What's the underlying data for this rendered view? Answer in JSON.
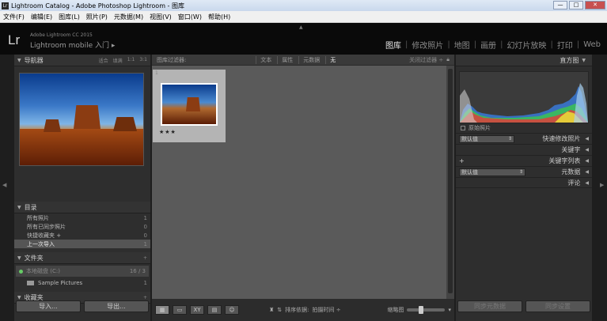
{
  "window": {
    "title": "Lightroom Catalog - Adobe Photoshop Lightroom - 图库",
    "app_icon": "Lr",
    "controls": [
      "—",
      "□",
      "✕"
    ]
  },
  "menu": [
    "文件(F)",
    "编辑(E)",
    "图库(L)",
    "照片(P)",
    "元数据(M)",
    "视图(V)",
    "窗口(W)",
    "帮助(H)"
  ],
  "identity": {
    "logo": "Lr",
    "brand_small": "Adobe Lightroom CC 2015",
    "brand_large": "Lightroom mobile 入门",
    "brand_arrow": "▸"
  },
  "modules": {
    "items": [
      "图库",
      "修改照片",
      "地图",
      "画册",
      "幻灯片放映",
      "打印",
      "Web"
    ],
    "active": "图库"
  },
  "navigator": {
    "title": "导航器",
    "zoom_options": [
      "适合",
      "填满",
      "1:1",
      "3:1"
    ]
  },
  "catalog": {
    "title": "目录",
    "items": [
      {
        "label": "所有照片",
        "count": "1"
      },
      {
        "label": "所有已同步照片",
        "count": "0"
      },
      {
        "label": "快捷收藏夹 +",
        "count": "0"
      },
      {
        "label": "上一次导入",
        "count": "1"
      }
    ]
  },
  "folders": {
    "title": "文件夹",
    "add": "+",
    "volume_label": "本地磁盘 (C:)",
    "volume_space": "16 / 3",
    "items": [
      {
        "label": "Sample Pictures",
        "count": "1"
      }
    ]
  },
  "collections": {
    "title": "收藏夹",
    "add": "+"
  },
  "left_buttons": {
    "import": "导入...",
    "export": "导出..."
  },
  "filter_bar": {
    "title": "图库过滤器:",
    "options": [
      "文本",
      "属性",
      "元数据",
      "无"
    ],
    "active": "无",
    "filter_off": "关闭过滤器 ÷"
  },
  "grid": {
    "cell_index": "1",
    "rating": "★★★"
  },
  "toolbar": {
    "sort_label": "排序依据:",
    "sort_value": "拍摄时间 ÷",
    "thumb_label": "缩略图",
    "thumbnail_size": 0.35
  },
  "histogram": {
    "title": "直方图",
    "original_label": "原始照片"
  },
  "right_panels": {
    "quick_develop": {
      "select": "默认值",
      "title": "快速修改照片"
    },
    "keywords": {
      "title": "关键字"
    },
    "keyword_list": {
      "add": "+",
      "title": "关键字列表"
    },
    "metadata": {
      "select": "默认值",
      "title": "元数据"
    },
    "comments": {
      "title": "评论"
    }
  },
  "right_buttons": {
    "sync_metadata": "同步元数据",
    "sync_settings": "同步设置"
  },
  "colors": {
    "panel": "#2e2e2e",
    "center": "#5a5a5a",
    "id_plate": "#0a0a0a",
    "active_module": "#e6e6e6"
  }
}
